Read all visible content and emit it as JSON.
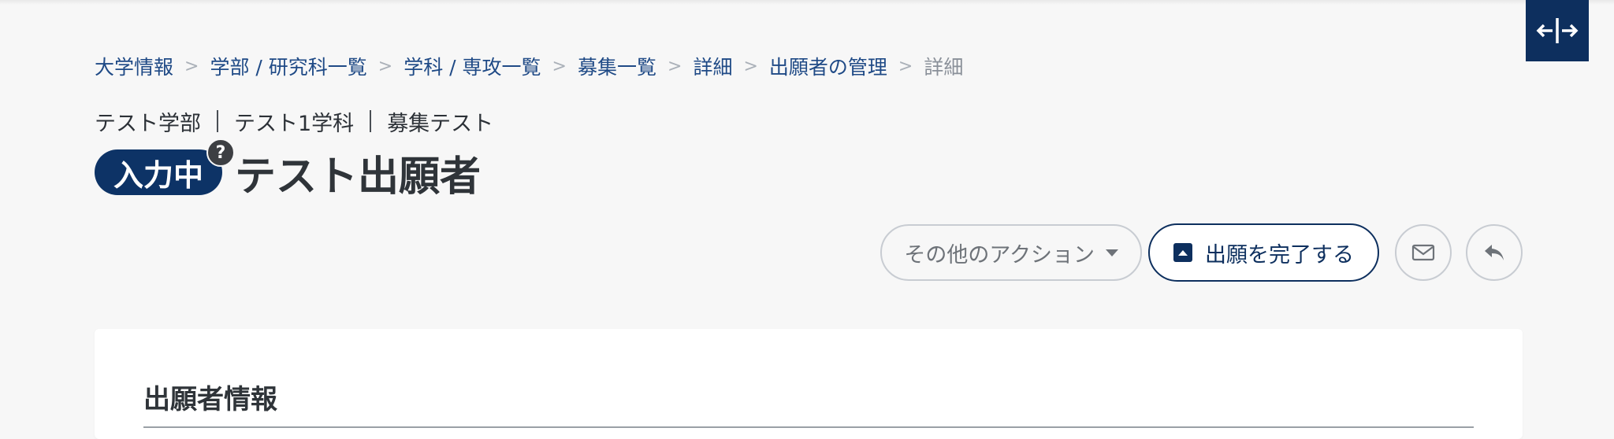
{
  "breadcrumb": {
    "items": [
      "大学情報",
      "学部 / 研究科一覧",
      "学科 / 専攻一覧",
      "募集一覧",
      "詳細",
      "出願者の管理"
    ],
    "current": "詳細",
    "separator": ">"
  },
  "subtitle": {
    "faculty": "テスト学部",
    "department": "テスト1学科",
    "recruitment": "募集テスト"
  },
  "header": {
    "status_badge": "入力中",
    "help_icon_glyph": "?",
    "title": "テスト出願者"
  },
  "actions": {
    "other_actions_label": "その他のアクション",
    "complete_label": "出願を完了する"
  },
  "card": {
    "title": "出願者情報"
  },
  "icons": {
    "toggle": "expand-horizontal-icon",
    "help": "question-mark-icon",
    "complete": "upload-box-icon",
    "mail": "mail-icon",
    "back": "reply-arrow-icon"
  },
  "colors": {
    "primary": "#0d2f5e",
    "link": "#1f4a86",
    "background": "#f7f7f7"
  }
}
